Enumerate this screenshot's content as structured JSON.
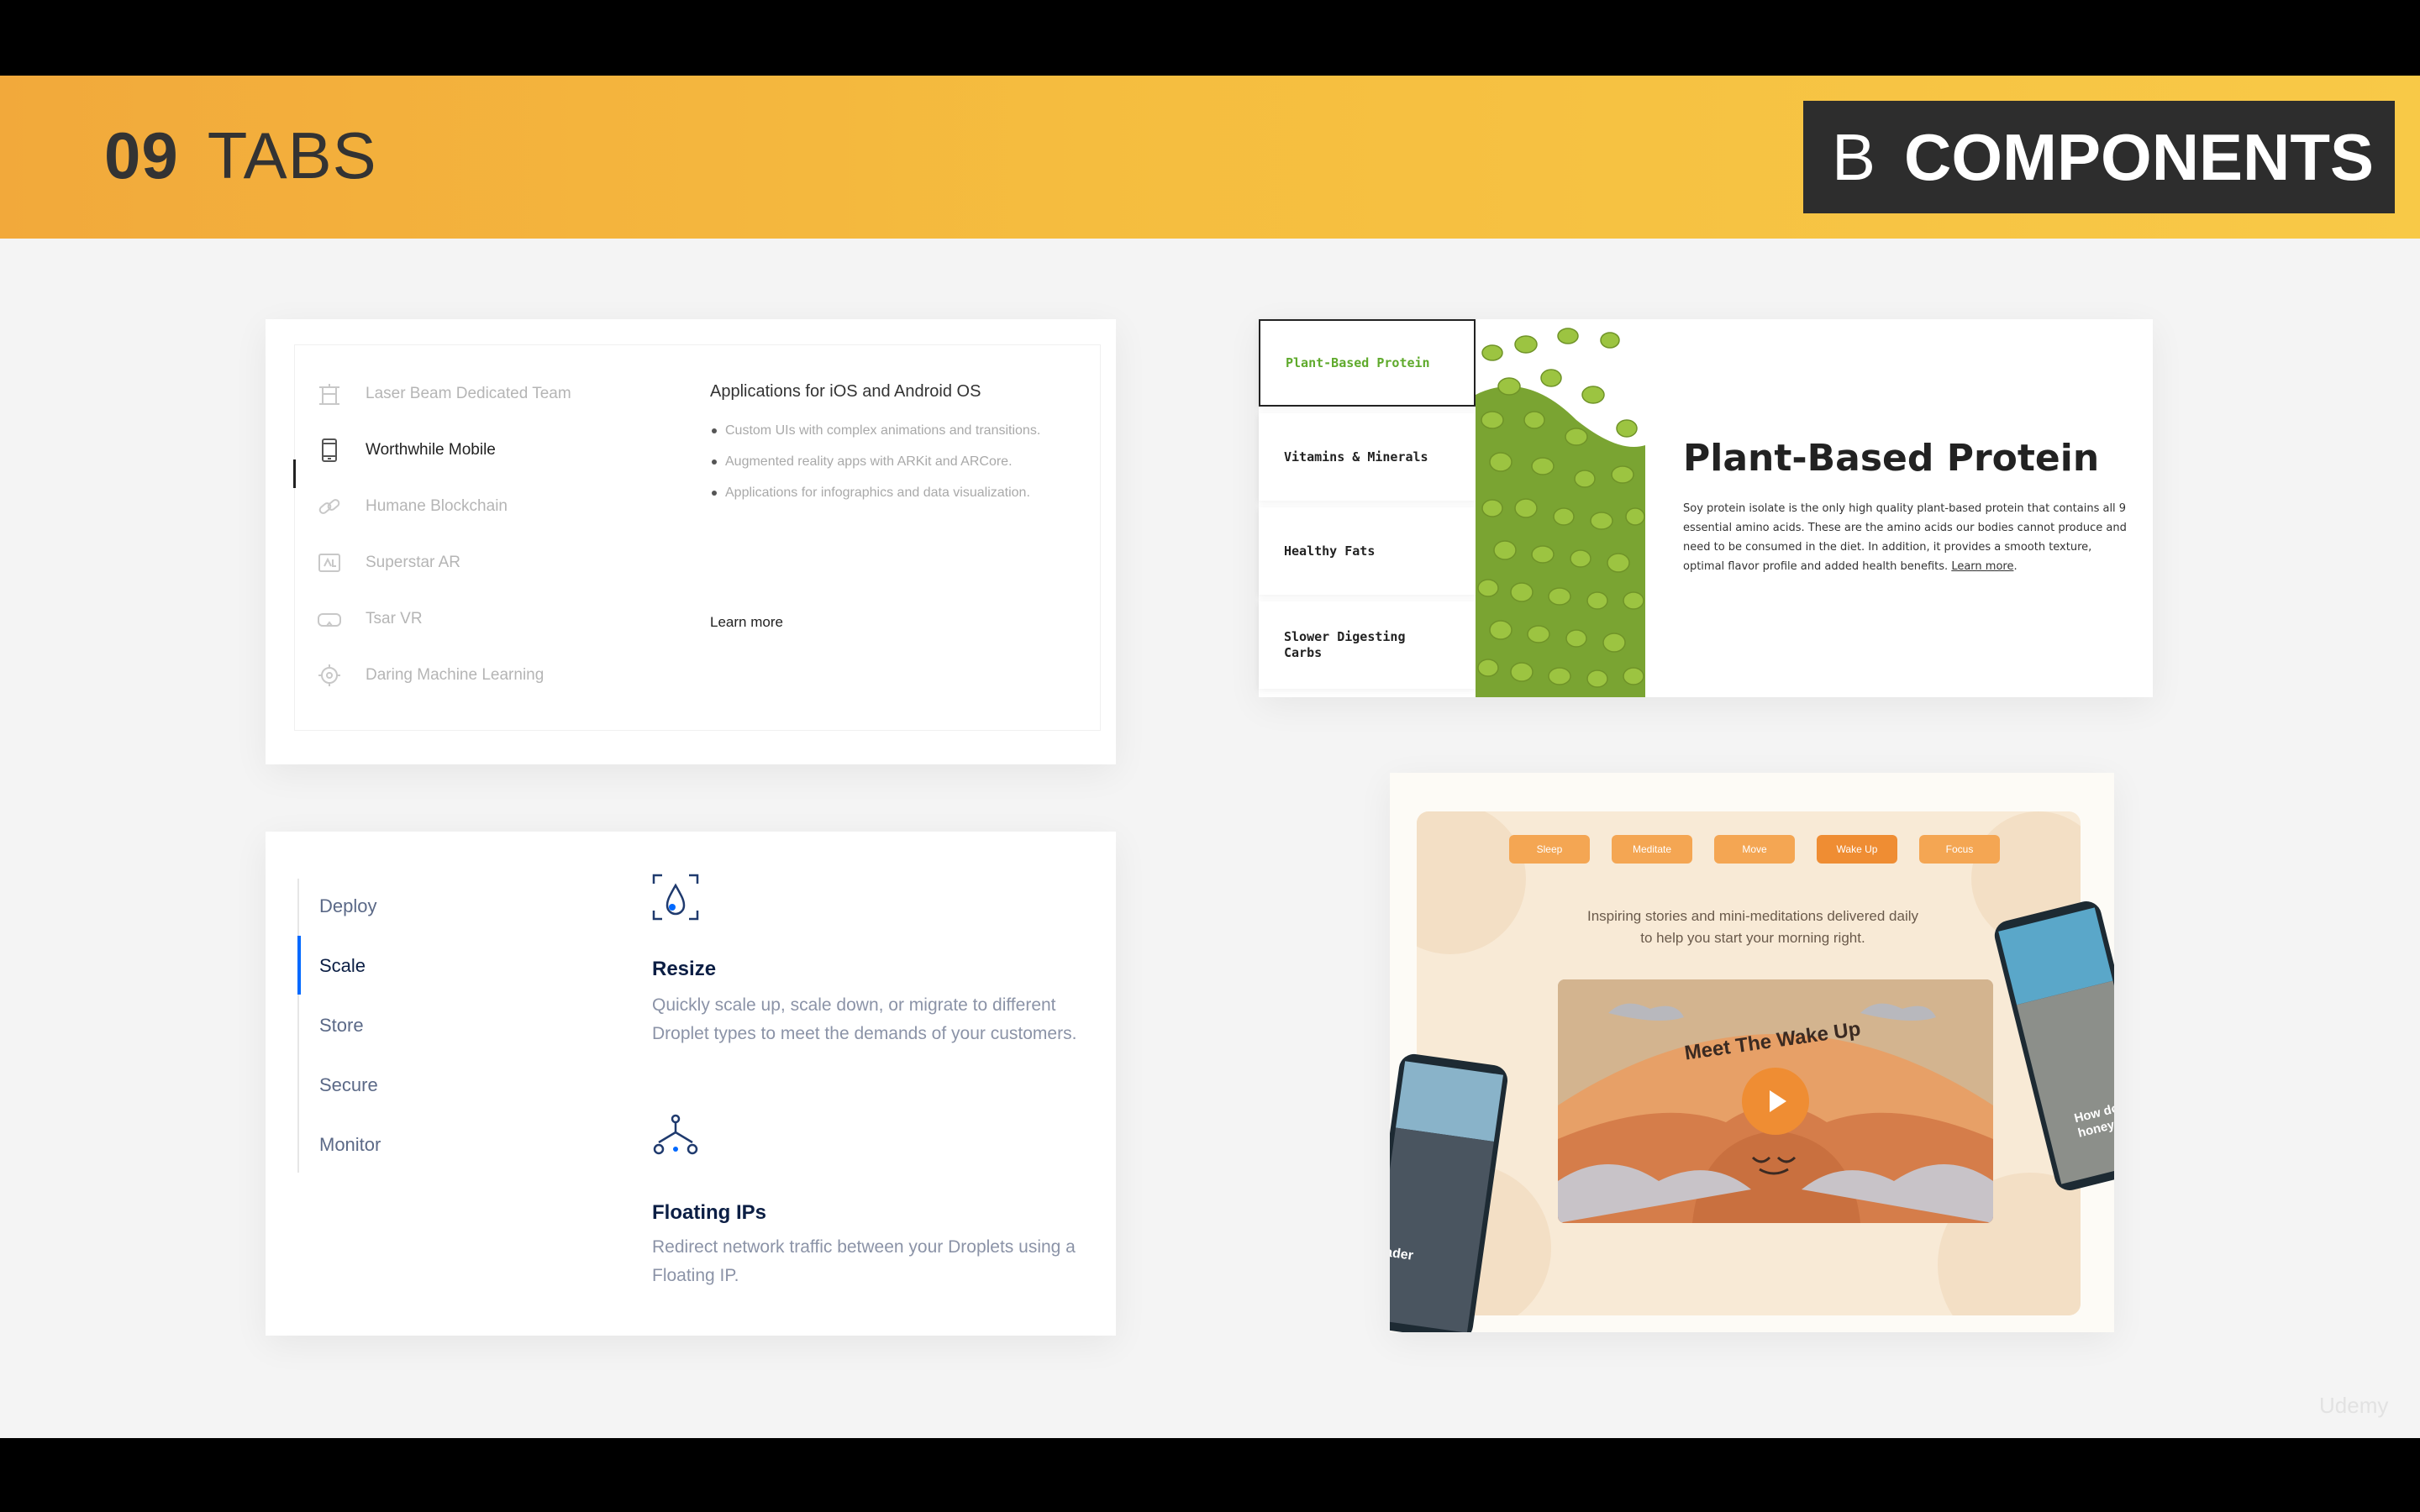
{
  "header": {
    "number": "09",
    "title": "TABS",
    "badge_letter": "B",
    "badge_text": "COMPONENTS"
  },
  "card1": {
    "items": [
      {
        "icon": "crane-icon",
        "label": "Laser Beam Dedicated Team"
      },
      {
        "icon": "mobile-icon",
        "label": "Worthwhile Mobile"
      },
      {
        "icon": "chain-icon",
        "label": "Humane Blockchain"
      },
      {
        "icon": "ar-icon",
        "label": "Superstar AR"
      },
      {
        "icon": "vr-headset-icon",
        "label": "Tsar VR"
      },
      {
        "icon": "gear-brain-icon",
        "label": "Daring Machine Learning"
      }
    ],
    "active_index": 1,
    "content_title": "Applications for iOS and Android OS",
    "bullets": [
      "Custom UIs with complex animations and transitions.",
      "Augmented reality apps with ARKit and ARCore.",
      "Applications for infographics and data visualization."
    ],
    "learn_more": "Learn more"
  },
  "card2": {
    "tabs": [
      "Plant-Based Protein",
      "Vitamins & Minerals",
      "Healthy Fats",
      "Slower Digesting Carbs"
    ],
    "active_index": 0,
    "heading": "Plant-Based Protein",
    "body": "Soy protein isolate is the only high quality plant-based protein that contains all 9 essential amino acids. These are the amino acids our bodies cannot produce and need to be consumed in the diet. In addition, it provides a smooth texture, optimal flavor profile and added health benefits.",
    "learn_more": "Learn more",
    "image": "edamame-beans-image"
  },
  "card3": {
    "tabs": [
      "Deploy",
      "Scale",
      "Store",
      "Secure",
      "Monitor"
    ],
    "active_index": 1,
    "features": [
      {
        "icon": "resize-icon",
        "title": "Resize",
        "text": "Quickly scale up, scale down, or migrate to different Droplet types to meet the demands of your customers."
      },
      {
        "icon": "floating-ip-icon",
        "title": "Floating IPs",
        "text": "Redirect network traffic between your Droplets using a Floating IP."
      }
    ]
  },
  "card4": {
    "tabs": [
      "Sleep",
      "Meditate",
      "Move",
      "Wake Up",
      "Focus"
    ],
    "active_index": 3,
    "caption": "Inspiring stories and mini-meditations delivered daily to help you start your morning right.",
    "video_title": "Meet The Wake Up",
    "play_icon": "play-icon",
    "phone_left_text": "ader",
    "phone_right_text": "How do honey b"
  },
  "watermark": "Udemy",
  "colors": {
    "banner_start": "#f2a93b",
    "banner_end": "#f8c947",
    "badge_bg": "#2d2d2d",
    "protein_green": "#5faa2c",
    "scale_blue": "#0069ff",
    "headspace_orange": "#ef8d33"
  }
}
